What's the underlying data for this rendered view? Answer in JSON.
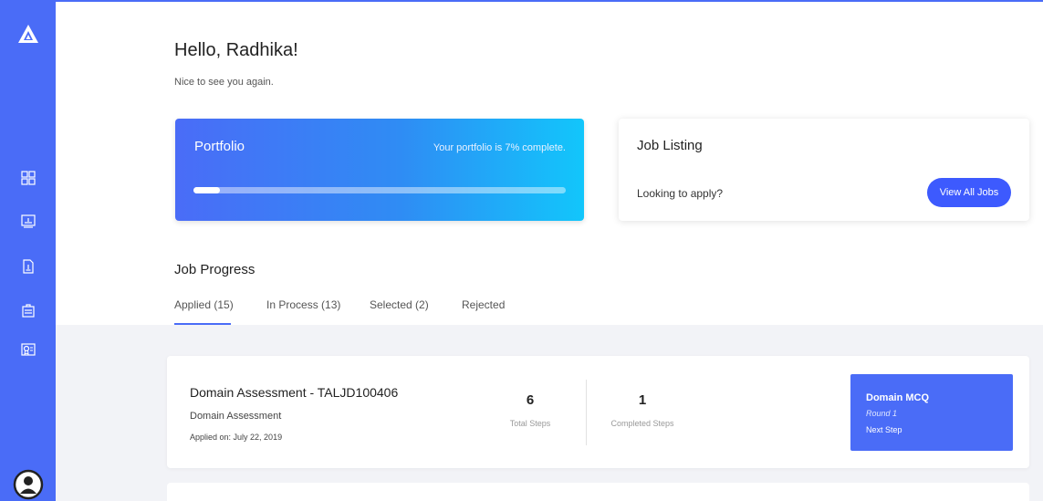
{
  "sidebar": {
    "nav_icons": [
      "dashboard-grid-icon",
      "monitor-icon",
      "document-icon",
      "briefcase-icon",
      "certificate-icon"
    ],
    "accent_color": "#4a6cf7"
  },
  "greeting": {
    "title": "Hello, Radhika!",
    "subtitle": "Nice to see you again."
  },
  "portfolio": {
    "title": "Portfolio",
    "status": "Your portfolio is 7% complete.",
    "progress": 0.07
  },
  "job_listing": {
    "title": "Job Listing",
    "prompt": "Looking to apply?",
    "button_label": "View All Jobs"
  },
  "job_progress": {
    "title": "Job Progress",
    "tabs": [
      {
        "label": "Applied (15)",
        "active": true
      },
      {
        "label": "In Process (13)",
        "active": false
      },
      {
        "label": "Selected (2)",
        "active": false
      },
      {
        "label": "Rejected",
        "active": false
      }
    ]
  },
  "jobs": [
    {
      "title": "Domain Assessment - TALJD100406",
      "type": "Domain Assessment",
      "applied": "Applied on: July 22, 2019",
      "total_steps": "6",
      "total_steps_label": "Total Steps",
      "completed_steps": "1",
      "completed_steps_label": "Completed Steps",
      "next_step": {
        "title": "Domain MCQ",
        "round": "Round 1",
        "label": "Next Step"
      }
    }
  ]
}
